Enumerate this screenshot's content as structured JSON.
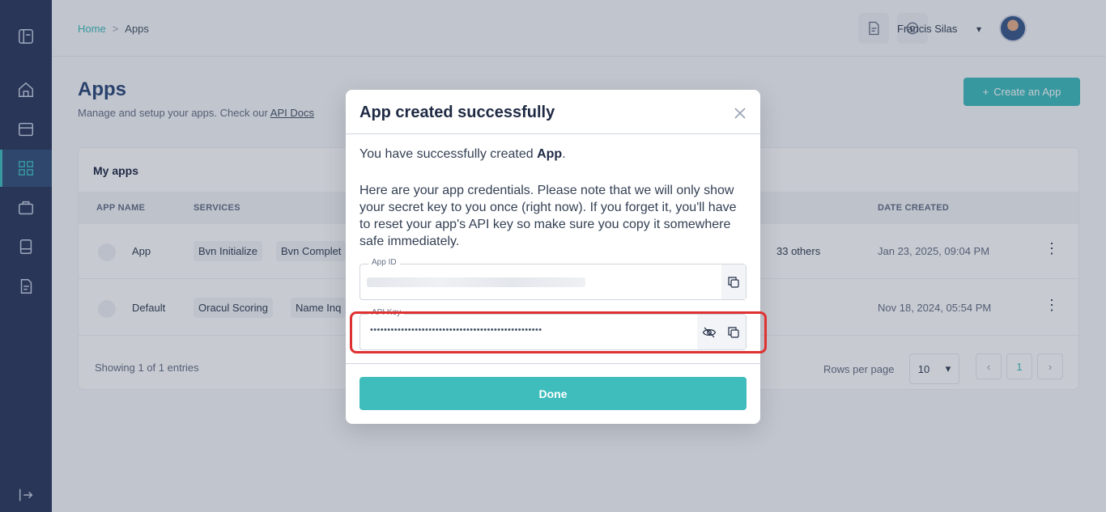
{
  "header": {
    "breadcrumb": [
      "Home",
      "Apps"
    ],
    "breadcrumb_sep": ">",
    "user_name": "Francis Silas"
  },
  "page": {
    "title": "Apps",
    "subtitle": "Manage and setup your apps. Check our",
    "subtitle_link": "API Docs",
    "create_button": "Create an App",
    "create_icon": "+"
  },
  "table": {
    "title": "My apps",
    "headers": [
      "APP NAME",
      "SERVICES",
      "DATE CREATED"
    ],
    "rows": [
      {
        "name": "App",
        "services": [
          "Bvn Initialize",
          "Bvn Complet"
        ],
        "others": "33 others",
        "date": "Jan 23, 2025, 09:04 PM"
      },
      {
        "name": "Default",
        "services": [
          "Oracul Scoring",
          "Name Inq"
        ],
        "others": "",
        "date": "Nov 18, 2024, 05:54 PM"
      }
    ],
    "row_menu": "⋮",
    "footer": "Showing 1 of 1 entries",
    "rows_per_page_label": "Rows per page",
    "rows_per_page_value": "10",
    "current_page": "1"
  },
  "modal": {
    "title": "App created successfully",
    "message_prefix": "You have successfully created ",
    "message_app": "App",
    "message_suffix": ".",
    "note": "Here are your app credentials. Please note that we will only show your secret key to you once (right now). If you forget it, you'll have to reset your app's API key so make sure you copy it somewhere safe immediately.",
    "app_id_label": "App ID",
    "api_key_label": "API Key",
    "api_key_masked": "••••••••••••••••••••••••••••••••••••••••••••••••••",
    "done_button": "Done"
  },
  "colors": {
    "accent": "#3fbcbc",
    "sidebar": "#2c3a5c",
    "highlight": "#e03131"
  },
  "icons": {
    "sidebar": [
      "dashboard-icon",
      "home-icon",
      "store-icon",
      "apps-grid-icon",
      "briefcase-icon",
      "book-icon",
      "document-icon",
      "logout-icon"
    ],
    "header": [
      "document-icon",
      "gear-icon",
      "chevron-down-icon"
    ],
    "field": [
      "copy-icon",
      "eye-off-icon"
    ]
  }
}
